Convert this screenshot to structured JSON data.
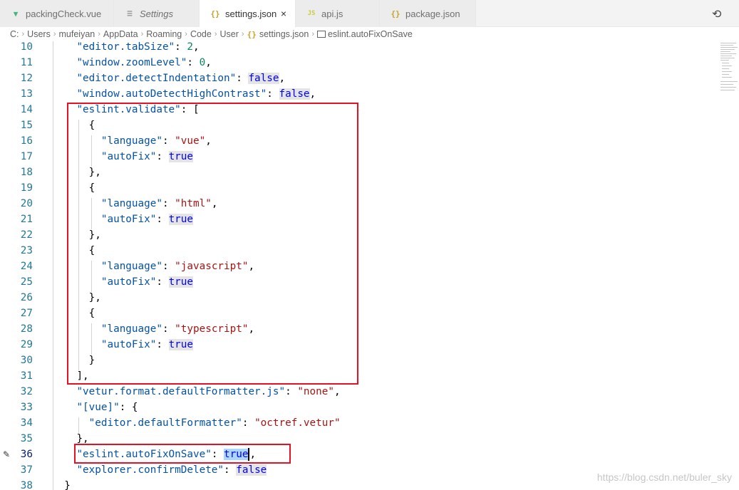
{
  "tabs": [
    {
      "label": "packingCheck.vue",
      "icon": "vue-icon"
    },
    {
      "label": "Settings",
      "icon": "settings-list-icon"
    },
    {
      "label": "settings.json",
      "icon": "json-icon",
      "active": true,
      "close": "×"
    },
    {
      "label": "api.js",
      "icon": "js-icon"
    },
    {
      "label": "package.json",
      "icon": "json-icon"
    }
  ],
  "icons": {
    "json": "{}",
    "js": "JS",
    "vue": "V",
    "settings": "≡",
    "split": "⟲"
  },
  "breadcrumb": [
    "C:",
    "Users",
    "mufeiyan",
    "AppData",
    "Roaming",
    "Code",
    "User",
    "settings.json",
    "eslint.autoFixOnSave"
  ],
  "lines": [
    {
      "n": "10",
      "t": "    \"editor.tabSize\": 2,"
    },
    {
      "n": "11",
      "t": "    \"window.zoomLevel\": 0,"
    },
    {
      "n": "12",
      "t": "    \"editor.detectIndentation\": false,"
    },
    {
      "n": "13",
      "t": "    \"window.autoDetectHighContrast\": false,"
    },
    {
      "n": "14",
      "t": "    \"eslint.validate\": ["
    },
    {
      "n": "15",
      "t": "      {"
    },
    {
      "n": "16",
      "t": "        \"language\": \"vue\","
    },
    {
      "n": "17",
      "t": "        \"autoFix\": true"
    },
    {
      "n": "18",
      "t": "      },"
    },
    {
      "n": "19",
      "t": "      {"
    },
    {
      "n": "20",
      "t": "        \"language\": \"html\","
    },
    {
      "n": "21",
      "t": "        \"autoFix\": true"
    },
    {
      "n": "22",
      "t": "      },"
    },
    {
      "n": "23",
      "t": "      {"
    },
    {
      "n": "24",
      "t": "        \"language\": \"javascript\","
    },
    {
      "n": "25",
      "t": "        \"autoFix\": true"
    },
    {
      "n": "26",
      "t": "      },"
    },
    {
      "n": "27",
      "t": "      {"
    },
    {
      "n": "28",
      "t": "        \"language\": \"typescript\","
    },
    {
      "n": "29",
      "t": "        \"autoFix\": true"
    },
    {
      "n": "30",
      "t": "      }"
    },
    {
      "n": "31",
      "t": "    ],"
    },
    {
      "n": "32",
      "t": "    \"vetur.format.defaultFormatter.js\": \"none\","
    },
    {
      "n": "33",
      "t": "    \"[vue]\": {"
    },
    {
      "n": "34",
      "t": "      \"editor.defaultFormatter\": \"octref.vetur\""
    },
    {
      "n": "35",
      "t": "    },"
    },
    {
      "n": "36",
      "t": "    \"eslint.autoFixOnSave\": true,"
    },
    {
      "n": "37",
      "t": "    \"explorer.confirmDelete\": false"
    },
    {
      "n": "38",
      "t": "  }"
    }
  ],
  "current_line": "36",
  "watermark": "https://blog.csdn.net/buler_sky",
  "colors": {
    "red_box": "#e81123",
    "line_number": "#237893",
    "key": "#0451a5",
    "string": "#a31515",
    "number": "#098658",
    "keyword": "#0000ff"
  }
}
